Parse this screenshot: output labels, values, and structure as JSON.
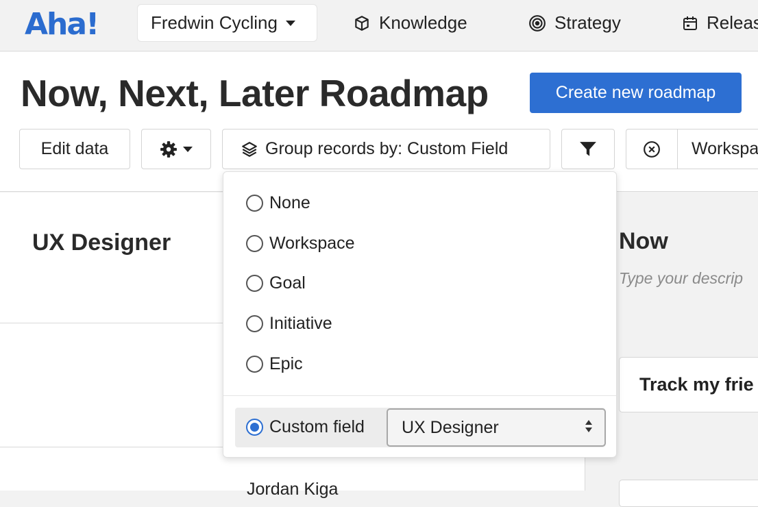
{
  "brand": {
    "logo": "Aha!",
    "accent": "#2d6fd2"
  },
  "nav": {
    "workspace": "Fredwin Cycling",
    "links": [
      {
        "label": "Knowledge",
        "icon": "cube-icon"
      },
      {
        "label": "Strategy",
        "icon": "target-icon"
      },
      {
        "label": "Releas",
        "icon": "calendar-icon"
      }
    ]
  },
  "page": {
    "title": "Now, Next, Later Roadmap",
    "create_button": "Create new roadmap"
  },
  "toolbar": {
    "edit_data": "Edit data",
    "group_by": "Group records by: Custom Field",
    "workspace_filter": "Workspa"
  },
  "group_menu": {
    "options": [
      "None",
      "Workspace",
      "Goal",
      "Initiative",
      "Epic"
    ],
    "custom_label": "Custom field",
    "custom_value": "UX Designer",
    "selected": "Custom field"
  },
  "board": {
    "lane_title": "UX Designer",
    "column_title": "Now",
    "column_placeholder": "Type your descrip",
    "card_title": "Track my frie",
    "next_lane_label": "Jordan Kiga"
  }
}
